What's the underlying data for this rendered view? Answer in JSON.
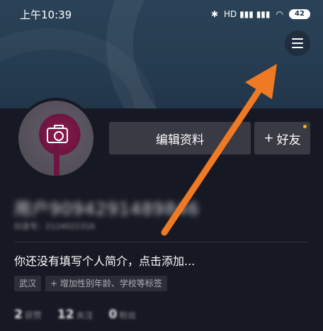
{
  "status_bar": {
    "time": "上午10:39",
    "signal": "HD ▮▮▮ ▮▮▮",
    "battery": "42"
  },
  "header": {
    "menu_icon": "hamburger-menu-icon"
  },
  "profile": {
    "avatar_icon": "camera-icon",
    "edit_button_label": "编辑资料",
    "add_friend_label": "好友",
    "add_friend_icon": "+",
    "username": "用户9094291489846",
    "douyin_id": "抖音号：2124022316",
    "bio": "你还没有填写个人简介，点击添加...",
    "tags": [
      "武汉",
      "+ 增加性别年龄、学校等标签"
    ]
  },
  "stats": [
    {
      "num": "2",
      "label": "获赞"
    },
    {
      "num": "12",
      "label": "关注"
    },
    {
      "num": "0",
      "label": "粉丝"
    }
  ],
  "annotation": {
    "arrow_color": "#f07a23"
  }
}
